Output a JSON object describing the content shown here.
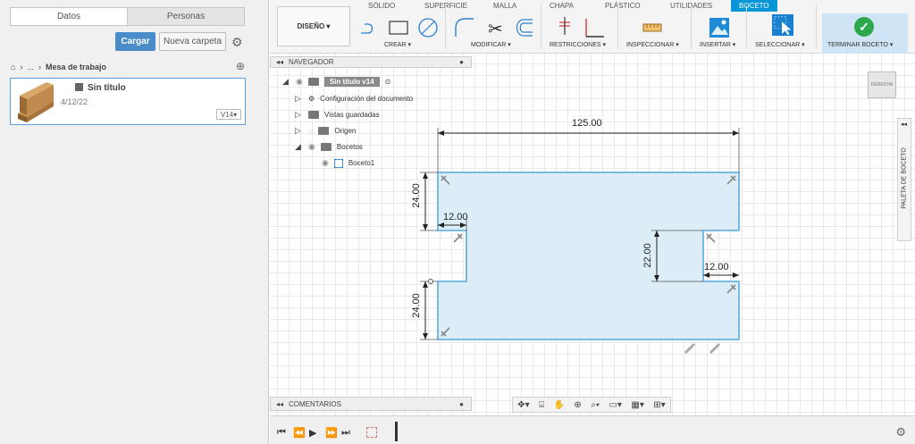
{
  "data_panel": {
    "tabs": [
      "Datos",
      "Personas"
    ],
    "upload_label": "Cargar",
    "new_folder_label": "Nueva carpeta",
    "breadcrumb": {
      "ellipsis": "...",
      "location": "Mesa de trabajo"
    },
    "file": {
      "name": "Sin título",
      "date": "4/12/22",
      "version": "V14▾"
    }
  },
  "toolbar": {
    "workspace_tabs": [
      "SÓLIDO",
      "SUPERFICIE",
      "MALLA",
      "CHAPA",
      "PLÁSTICO",
      "UTILIDADES",
      "BOCETO"
    ],
    "active_tab": "BOCETO",
    "design_label": "DISEÑO ▾",
    "groups": [
      "CREAR ▾",
      "MODIFICAR ▾",
      "RESTRICCIONES ▾",
      "INSPECCIONAR ▾",
      "INSERTAR ▾",
      "SELECCIONAR ▾"
    ],
    "finish_label": "TERMINAR BOCETO ▾",
    "accent_color": "#0696d7",
    "finish_color": "#2ea84d"
  },
  "browser": {
    "title": "NAVEGADOR",
    "root": "Sin título v14",
    "items": [
      "Configuración del documento",
      "Vistas guardadas",
      "Origen",
      "Bocetos",
      "Boceto1"
    ]
  },
  "sketch": {
    "dims": [
      "125.00",
      "24.00",
      "12.00",
      "24.00",
      "22.00",
      "12.00"
    ]
  },
  "viewcube_label": "DERECHA",
  "palette_label": "PALETA DE BOCETO",
  "comments_label": "COMENTARIOS"
}
